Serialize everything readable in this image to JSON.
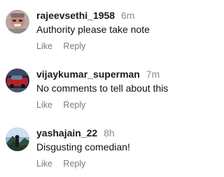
{
  "comments": [
    {
      "username": "rajeevsethi_1958",
      "time": "6m",
      "text": "Authority please take note",
      "like_label": "Like",
      "reply_label": "Reply",
      "avatar": "face-photo"
    },
    {
      "username": "vijaykumar_superman",
      "time": "7m",
      "text": "No comments to tell about this",
      "like_label": "Like",
      "reply_label": "Reply",
      "avatar": "red-car-photo"
    },
    {
      "username": "yashajain_22",
      "time": "8h",
      "text": "Disgusting comedian!",
      "like_label": "Like",
      "reply_label": "Reply",
      "avatar": "landscape-photo"
    }
  ],
  "colors": {
    "meta_gray": "#8a8a8a",
    "action_gray": "#7a7a7a",
    "text": "#111111"
  }
}
